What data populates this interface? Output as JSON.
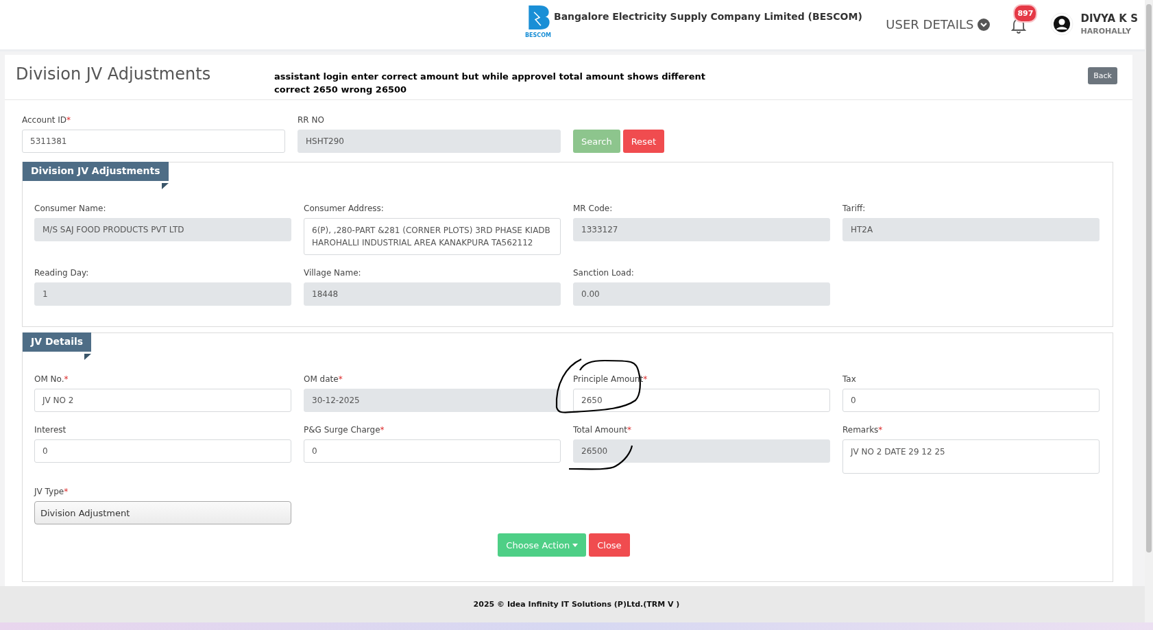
{
  "header": {
    "logo_text": "BESCOM",
    "company": "Bangalore Electricity Supply Company Limited (BESCOM)",
    "user_details": "USER DETAILS",
    "notification_count": "897",
    "user_name": "DIVYA K S",
    "user_location": "HAROHALLY"
  },
  "page": {
    "title": "Division JV Adjustments",
    "note_lines": [
      "assistant login enter correct amount but while approvel total amount shows different",
      "correct 2650 wrong 26500"
    ],
    "back_button": "Back"
  },
  "search": {
    "fields": [
      {
        "label": "Account ID",
        "required_mark": "*",
        "value": "5311381",
        "disabled": false
      },
      {
        "label": "RR NO",
        "value": "HSHT290",
        "disabled": true
      }
    ],
    "buttons": [
      {
        "label": "Search",
        "kind": "search"
      },
      {
        "label": "Reset",
        "kind": "reset"
      }
    ]
  },
  "sections": [
    {
      "title": "Division JV Adjustments",
      "fields": [
        {
          "label": "Consumer Name:",
          "value": "M/S SAJ FOOD PRODUCTS PVT LTD",
          "disabled": true,
          "kind": "input"
        },
        {
          "label": "Consumer Address:",
          "value": "6(P), ,280-PART &281 (CORNER PLOTS) 3RD PHASE KIADB HAROHALLI INDUSTRIAL AREA KANAKPURA TA562112",
          "disabled": false,
          "kind": "textarea"
        },
        {
          "label": "MR Code:",
          "value": "1333127",
          "disabled": true,
          "kind": "input"
        },
        {
          "label": "Tariff:",
          "value": "HT2A",
          "disabled": true,
          "kind": "input"
        },
        {
          "label": "Reading Day:",
          "value": "1",
          "disabled": true,
          "kind": "input"
        },
        {
          "label": "Village Name:",
          "value": "18448",
          "disabled": true,
          "kind": "input"
        },
        {
          "label": "Sanction Load:",
          "value": "0.00",
          "disabled": true,
          "kind": "input"
        }
      ]
    },
    {
      "title": "JV Details",
      "fields": [
        {
          "label": "OM No.",
          "required_mark": "*",
          "value": "JV NO 2",
          "disabled": false,
          "kind": "input"
        },
        {
          "label": "OM date",
          "required_mark": "*",
          "value": "30-12-2025",
          "disabled": true,
          "kind": "input"
        },
        {
          "label": "Principle Amount",
          "required_mark": "*",
          "value": "2650",
          "disabled": false,
          "kind": "input"
        },
        {
          "label": "Tax",
          "value": "0",
          "disabled": false,
          "kind": "input"
        },
        {
          "label": "Interest",
          "value": "0",
          "disabled": false,
          "kind": "input"
        },
        {
          "label": "P&G Surge Charge",
          "required_mark": "*",
          "value": "0",
          "disabled": false,
          "kind": "input"
        },
        {
          "label": "Total Amount",
          "required_mark": "*",
          "value": "26500",
          "disabled": true,
          "kind": "input"
        },
        {
          "label": "Remarks",
          "required_mark": "*",
          "value": "JV NO 2 DATE 29 12 25",
          "disabled": false,
          "kind": "textarea"
        },
        {
          "label": "JV Type",
          "required_mark": "*",
          "value": "Division Adjustment",
          "disabled": false,
          "kind": "select"
        }
      ]
    }
  ],
  "actions": [
    {
      "label": "Choose Action",
      "kind": "dropdown"
    },
    {
      "label": "Close",
      "kind": "close"
    }
  ],
  "footer": "2025 © Idea Infinity IT Solutions (P)Ltd.(TRM V )"
}
